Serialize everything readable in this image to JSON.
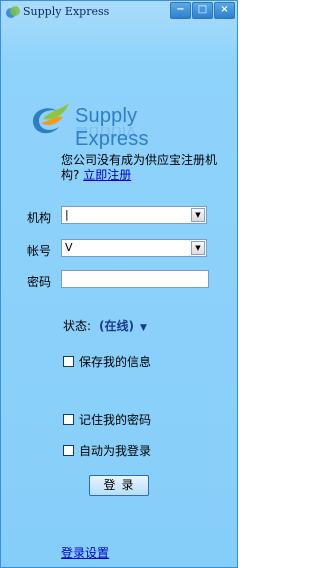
{
  "window": {
    "title": "Supply Express",
    "minimize_label": "−",
    "maximize_label": "□",
    "close_label": "×"
  },
  "logo": {
    "text": "Supply Express"
  },
  "notice": {
    "text": "您公司没有成为供应宝注册机构?",
    "link": "立即注册"
  },
  "form": {
    "org_label": "机构",
    "org_value": "|",
    "account_label": "帐号",
    "account_value": "V",
    "password_label": "密码",
    "password_value": ""
  },
  "status": {
    "label": "状态:",
    "value": "(在线)"
  },
  "options": {
    "save_info": "保存我的信息",
    "remember_password": "记住我的密码",
    "auto_login": "自动为我登录"
  },
  "login_button": "登录",
  "login_settings": "登录设置",
  "colors": {
    "background": "#8fd3fb",
    "link": "#0000cc",
    "logo": "#2f7ec5"
  }
}
